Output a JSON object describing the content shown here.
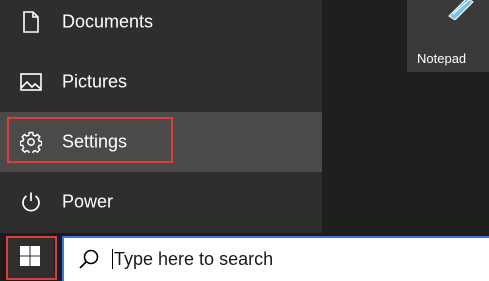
{
  "start_menu": {
    "items": [
      {
        "label": "Documents",
        "icon": "document-icon"
      },
      {
        "label": "Pictures",
        "icon": "pictures-icon"
      },
      {
        "label": "Settings",
        "icon": "gear-icon",
        "selected": true
      },
      {
        "label": "Power",
        "icon": "power-icon"
      }
    ]
  },
  "tiles": {
    "notepad_label": "Notepad"
  },
  "taskbar": {
    "start_icon": "windows-logo-icon",
    "search_placeholder": "Type here to search"
  },
  "colors": {
    "highlight": "#e03c3c",
    "search_border": "#3a78d6"
  }
}
